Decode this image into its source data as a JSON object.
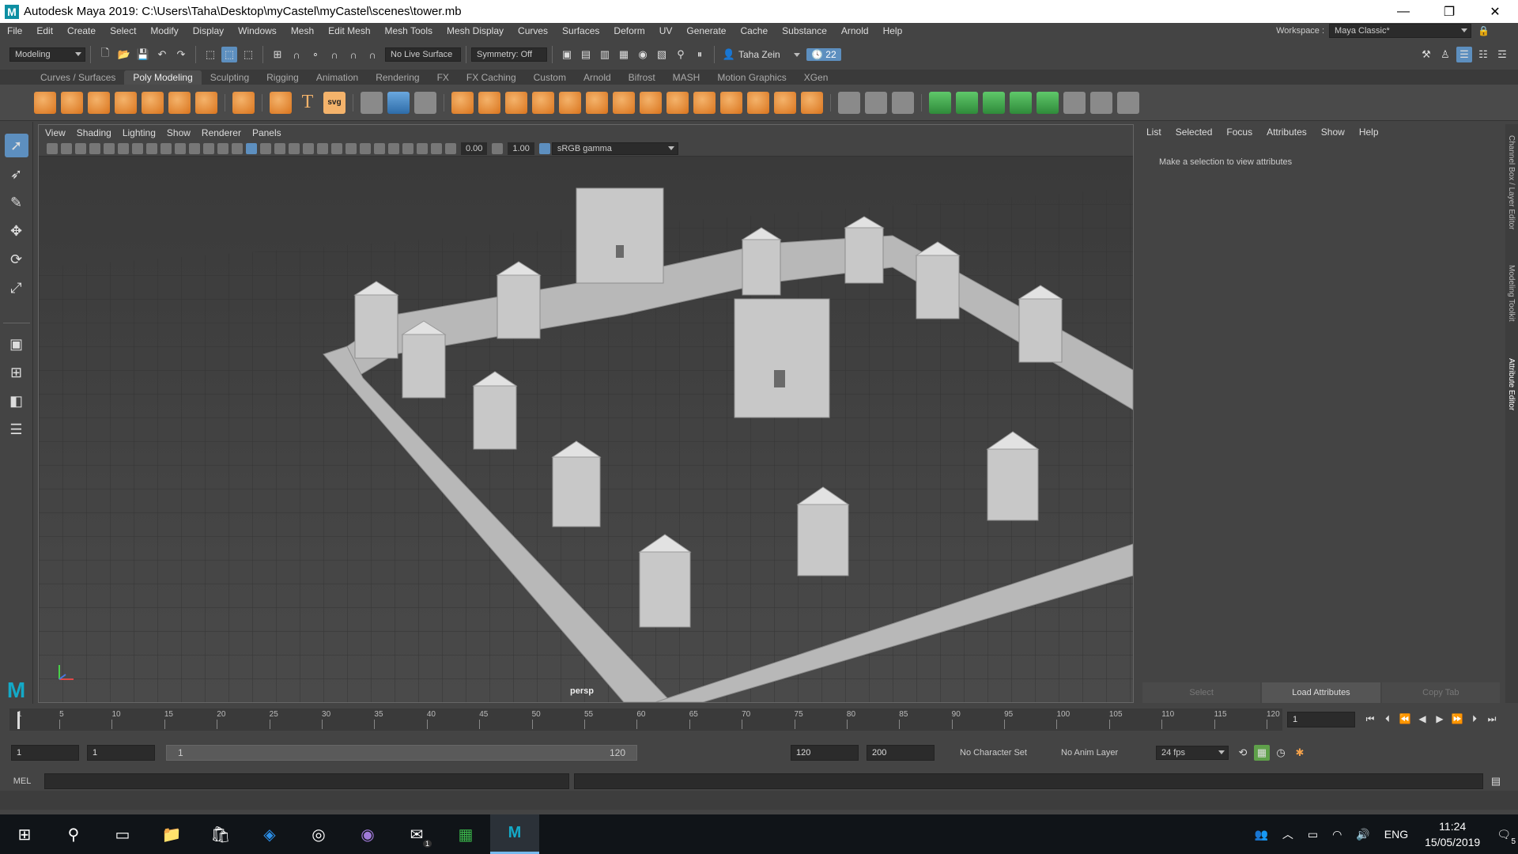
{
  "window": {
    "title": "Autodesk Maya 2019: C:\\Users\\Taha\\Desktop\\myCastel\\myCastel\\scenes\\tower.mb",
    "minimize": "—",
    "maximize": "❐",
    "close": "✕"
  },
  "menubar": {
    "items": [
      "File",
      "Edit",
      "Create",
      "Select",
      "Modify",
      "Display",
      "Windows",
      "Mesh",
      "Edit Mesh",
      "Mesh Tools",
      "Mesh Display",
      "Curves",
      "Surfaces",
      "Deform",
      "UV",
      "Generate",
      "Cache",
      "Substance",
      "Arnold",
      "Help"
    ],
    "workspace_label": "Workspace :",
    "workspace_value": "Maya Classic*"
  },
  "statusline": {
    "menuset": "Modeling",
    "live_surface": "No Live Surface",
    "symmetry": "Symmetry: Off",
    "user": "Taha Zein",
    "notifications": "22"
  },
  "shelf": {
    "tabs": [
      "Curves / Surfaces",
      "Poly Modeling",
      "Sculpting",
      "Rigging",
      "Animation",
      "Rendering",
      "FX",
      "FX Caching",
      "Custom",
      "Arnold",
      "Bifrost",
      "MASH",
      "Motion Graphics",
      "XGen"
    ],
    "active_tab": "Poly Modeling",
    "text_icon": "T",
    "svg_icon": "svg"
  },
  "viewport": {
    "menus": [
      "View",
      "Shading",
      "Lighting",
      "Show",
      "Renderer",
      "Panels"
    ],
    "exposure": "0.00",
    "gamma": "1.00",
    "color_space": "sRGB gamma",
    "camera_label": "persp"
  },
  "attribute_editor": {
    "menus": [
      "List",
      "Selected",
      "Focus",
      "Attributes",
      "Show",
      "Help"
    ],
    "message": "Make a selection to view attributes",
    "buttons": [
      "Select",
      "Load Attributes",
      "Copy Tab"
    ]
  },
  "side_tabs": [
    "Channel Box / Layer Editor",
    "Modeling Toolkit",
    "Attribute Editor"
  ],
  "timeline": {
    "ticks": [
      "1",
      "5",
      "10",
      "15",
      "20",
      "25",
      "30",
      "35",
      "40",
      "45",
      "50",
      "55",
      "60",
      "65",
      "70",
      "75",
      "80",
      "85",
      "90",
      "95",
      "100",
      "105",
      "110",
      "115",
      "120"
    ],
    "current_frame": "1",
    "range_start": "1",
    "playback_start": "1",
    "slider_start": "1",
    "slider_end": "120",
    "playback_end": "120",
    "range_end": "200",
    "character_set": "No Character Set",
    "anim_layer": "No Anim Layer",
    "fps": "24 fps"
  },
  "command_line": {
    "label": "MEL"
  },
  "taskbar": {
    "language": "ENG",
    "time": "11:24",
    "date": "15/05/2019",
    "notification_count": "5",
    "mail_badge": "1"
  }
}
